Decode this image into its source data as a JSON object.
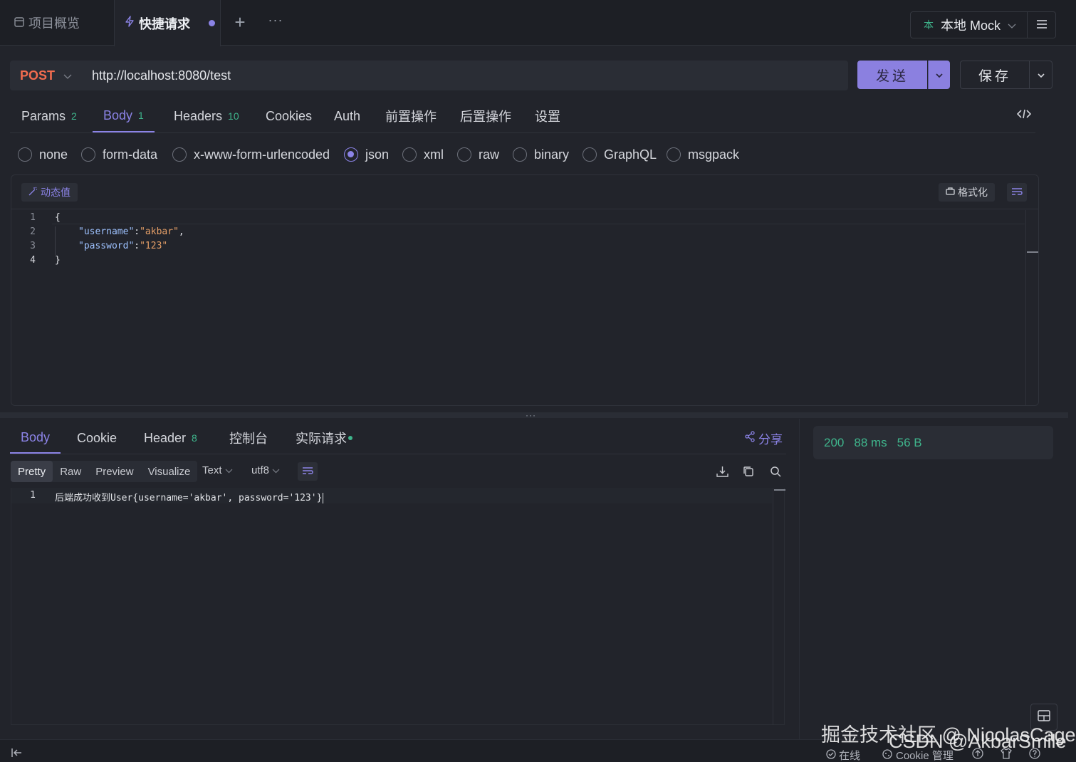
{
  "tabs": {
    "overview": "项目概览",
    "quick_request": "快捷请求",
    "add": "+",
    "more": "···"
  },
  "env": {
    "label": "本地 Mock",
    "prefix": "本"
  },
  "request": {
    "method": "POST",
    "url": "http://localhost:8080/test",
    "send_label": "发送",
    "save_label": "保存"
  },
  "req_tabs": [
    {
      "label": "Params",
      "count": "2"
    },
    {
      "label": "Body",
      "count": "1"
    },
    {
      "label": "Headers",
      "count": "10"
    },
    {
      "label": "Cookies",
      "count": ""
    },
    {
      "label": "Auth",
      "count": ""
    },
    {
      "label": "前置操作",
      "count": ""
    },
    {
      "label": "后置操作",
      "count": ""
    },
    {
      "label": "设置",
      "count": ""
    }
  ],
  "body_types": [
    "none",
    "form-data",
    "x-www-form-urlencoded",
    "json",
    "xml",
    "raw",
    "binary",
    "GraphQL",
    "msgpack"
  ],
  "body_selected": "json",
  "editor": {
    "dynamic_label": "动态值",
    "format_label": "格式化",
    "line_numbers": [
      "1",
      "2",
      "3",
      "4"
    ],
    "lines": {
      "l1": "{",
      "l2_key": "\"username\"",
      "l2_colon": ":",
      "l2_val": "\"akbar\"",
      "l2_comma": ",",
      "l3_key": "\"password\"",
      "l3_colon": ":",
      "l3_val": "\"123\"",
      "l4": "}"
    }
  },
  "resp_tabs": [
    {
      "label": "Body",
      "count": ""
    },
    {
      "label": "Cookie",
      "count": ""
    },
    {
      "label": "Header",
      "count": "8"
    },
    {
      "label": "控制台",
      "count": ""
    },
    {
      "label": "实际请求",
      "count": ""
    }
  ],
  "share_label": "分享",
  "status": {
    "code": "200",
    "time": "88 ms",
    "size": "56 B"
  },
  "resp_toolbar": {
    "views": [
      "Pretty",
      "Raw",
      "Preview",
      "Visualize"
    ],
    "format": "Text",
    "encoding": "utf8"
  },
  "response": {
    "line_number": "1",
    "content": "后端成功收到User{username='akbar', password='123'}"
  },
  "statusbar": {
    "online": "在线",
    "cookie": "Cookie 管理"
  },
  "watermarks": {
    "juejin": "掘金技术社区 @ NicolasCage",
    "csdn": "CSDN @AkbarSmile"
  },
  "colors": {
    "accent": "#8b83e6",
    "method": "#f26c4f",
    "success": "#3fb58c",
    "background": "#22242b"
  }
}
